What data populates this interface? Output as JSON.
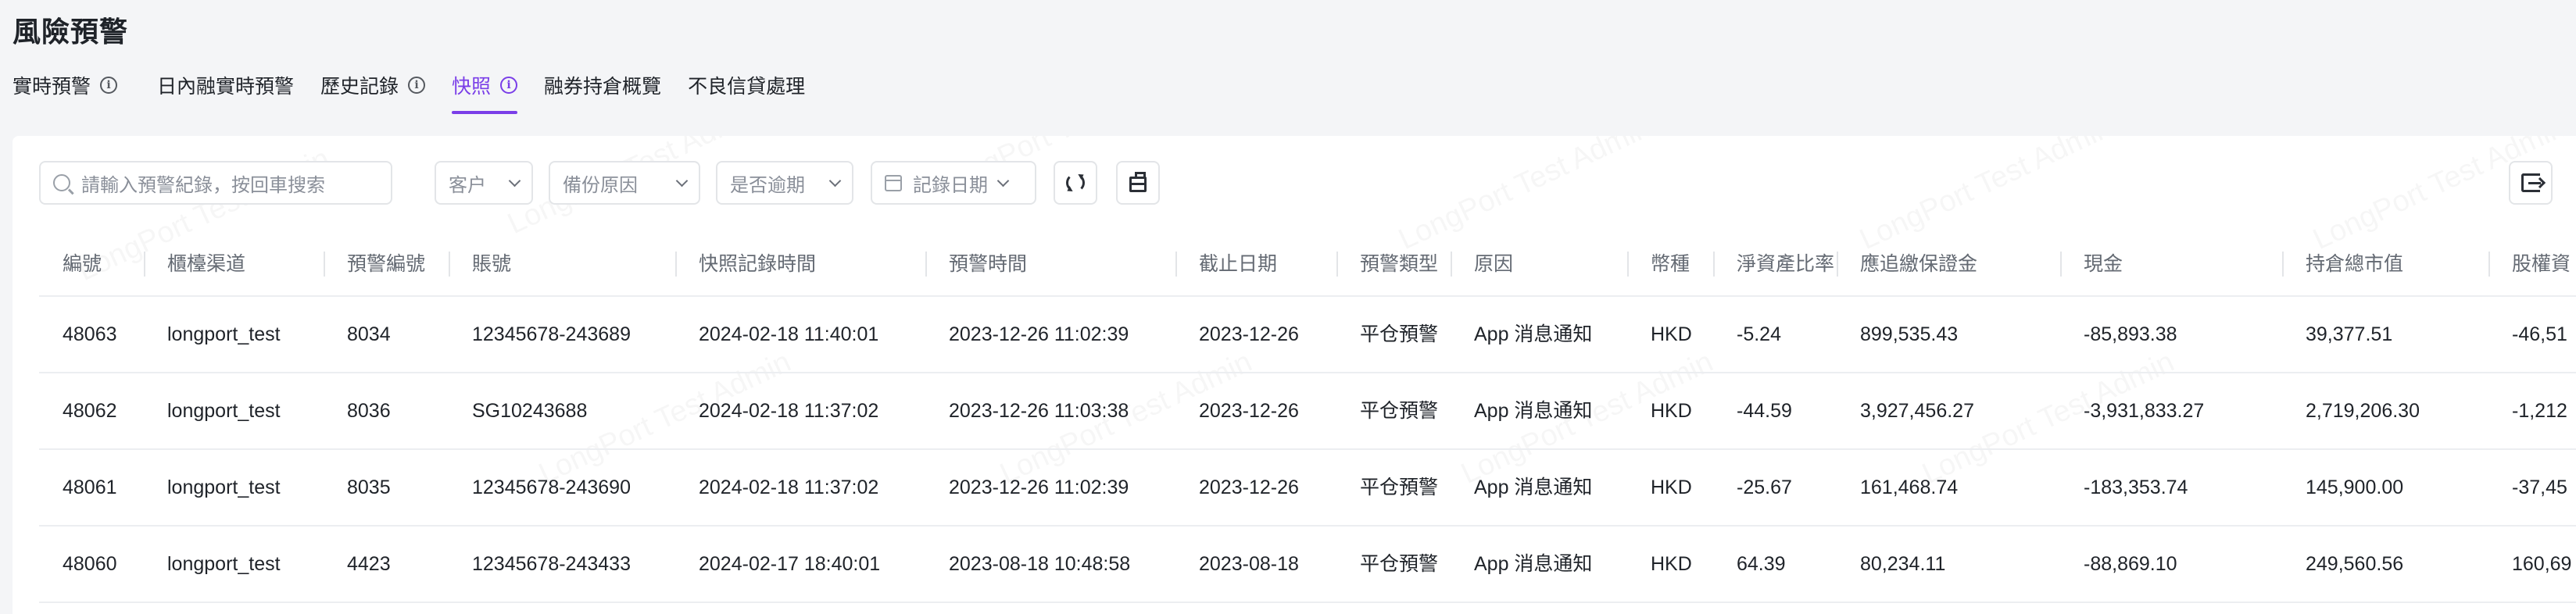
{
  "page": {
    "title": "風險預警"
  },
  "tabs": [
    {
      "label": "實時預警",
      "info": "i",
      "active": false
    },
    {
      "label": "日內融實時預警",
      "active": false
    },
    {
      "label": "歷史記錄",
      "info": "i",
      "active": false
    },
    {
      "label": "快照",
      "info": "i",
      "active": true
    },
    {
      "label": "融券持倉概覽",
      "active": false
    },
    {
      "label": "不良信貸處理",
      "active": false
    }
  ],
  "toolbar": {
    "search_placeholder": "請輸入預警紀錄，按回車搜索",
    "filters": {
      "customer": "客户",
      "backup_reason": "備份原因",
      "overdue": "是否逾期",
      "record_date": "記錄日期"
    },
    "icons": {
      "search": "search-icon",
      "refresh": "refresh-icon",
      "clear": "clear-filter-icon",
      "export": "export-icon",
      "calendar": "calendar-icon"
    }
  },
  "table": {
    "columns": [
      "編號",
      "櫃檯渠道",
      "預警編號",
      "賬號",
      "快照記錄時間",
      "預警時間",
      "截止日期",
      "預警類型",
      "原因",
      "幣種",
      "淨資產比率",
      "應追繳保證金",
      "現金",
      "持倉總市值",
      "股權資"
    ],
    "rows": [
      [
        "48063",
        "longport_test",
        "8034",
        "12345678-243689",
        "2024-02-18 11:40:01",
        "2023-12-26 11:02:39",
        "2023-12-26",
        "平仓預警",
        "App 消息通知",
        "HKD",
        "-5.24",
        "899,535.43",
        "-85,893.38",
        "39,377.51",
        "-46,51"
      ],
      [
        "48062",
        "longport_test",
        "8036",
        "SG10243688",
        "2024-02-18 11:37:02",
        "2023-12-26 11:03:38",
        "2023-12-26",
        "平仓預警",
        "App 消息通知",
        "HKD",
        "-44.59",
        "3,927,456.27",
        "-3,931,833.27",
        "2,719,206.30",
        "-1,212"
      ],
      [
        "48061",
        "longport_test",
        "8035",
        "12345678-243690",
        "2024-02-18 11:37:02",
        "2023-12-26 11:02:39",
        "2023-12-26",
        "平仓預警",
        "App 消息通知",
        "HKD",
        "-25.67",
        "161,468.74",
        "-183,353.74",
        "145,900.00",
        "-37,45"
      ],
      [
        "48060",
        "longport_test",
        "4423",
        "12345678-243433",
        "2024-02-17 18:40:01",
        "2023-08-18 10:48:58",
        "2023-08-18",
        "平仓預警",
        "App 消息通知",
        "HKD",
        "64.39",
        "80,234.11",
        "-88,869.10",
        "249,560.56",
        "160,69"
      ]
    ]
  },
  "watermark": "LongPort Test Admin",
  "colors": {
    "accent": "#7a3ee8",
    "text": "#1f2329",
    "muted": "#646a73",
    "border": "#e3e5e8",
    "bg": "#f4f5f7"
  }
}
